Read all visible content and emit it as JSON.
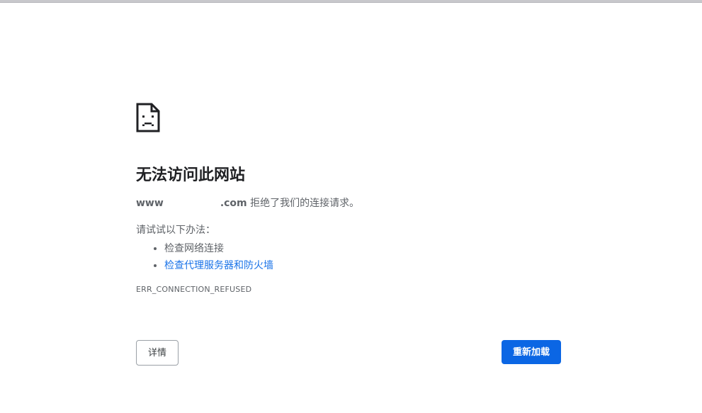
{
  "error": {
    "icon": "sad-page-icon",
    "title": "无法访问此网站",
    "host_prefix": "www",
    "host_suffix": ".com",
    "message": " 拒绝了我们的连接请求。",
    "suggest_label": "请试试以下办法：",
    "suggestions": [
      {
        "label": "检查网络连接",
        "link": false
      },
      {
        "label": "检查代理服务器和防火墙",
        "link": true
      }
    ],
    "code": "ERR_CONNECTION_REFUSED"
  },
  "buttons": {
    "details_label": "详情",
    "reload_label": "重新加载"
  },
  "colors": {
    "link": "#1a73e8",
    "primary_button": "#0b66e4",
    "text_secondary": "#5f6368"
  }
}
